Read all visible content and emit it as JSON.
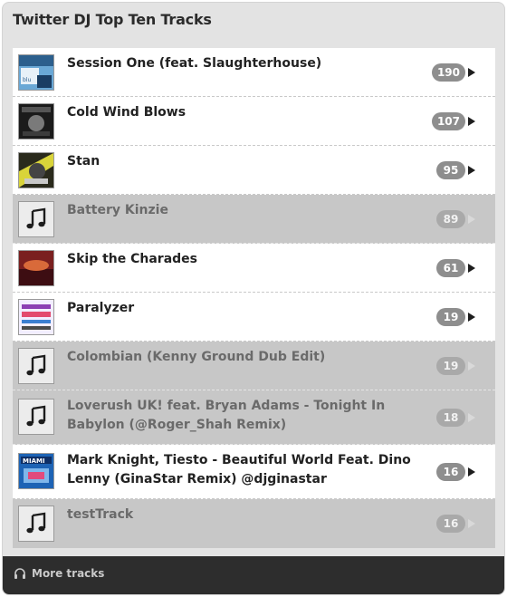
{
  "header": {
    "title": "Twitter DJ Top Ten Tracks"
  },
  "tracks": [
    {
      "title": "Session One (feat. Slaughterhouse)",
      "count": "190",
      "playable": true,
      "art": "art-session"
    },
    {
      "title": "Cold Wind Blows",
      "count": "107",
      "playable": true,
      "art": "art-cold"
    },
    {
      "title": "Stan",
      "count": "95",
      "playable": true,
      "art": "art-stan"
    },
    {
      "title": "Battery Kinzie",
      "count": "89",
      "playable": false,
      "art": "music-note-icon"
    },
    {
      "title": "Skip the Charades",
      "count": "61",
      "playable": true,
      "art": "art-skip"
    },
    {
      "title": "Paralyzer",
      "count": "19",
      "playable": true,
      "art": "art-paralyzer"
    },
    {
      "title": "Colombian (Kenny Ground Dub Edit)",
      "count": "19",
      "playable": false,
      "art": "music-note-icon"
    },
    {
      "title": "Loverush UK! feat. Bryan Adams - Tonight In Babylon (@Roger_Shah Remix)",
      "count": "18",
      "playable": false,
      "art": "music-note-icon"
    },
    {
      "title": "Mark Knight, Tiesto - Beautiful World Feat. Dino Lenny (GinaStar Remix) @djginastar",
      "count": "16",
      "playable": true,
      "art": "art-miami"
    },
    {
      "title": "testTrack",
      "count": "16",
      "playable": false,
      "art": "music-note-icon"
    }
  ],
  "footer": {
    "label": "More tracks",
    "icon": "headphones-icon"
  },
  "colors": {
    "panel_bg": "#e3e3e3",
    "disabled_row_bg": "#c7c7c7",
    "badge_bg": "#8e8e8e",
    "footer_bg": "#2d2d2d"
  }
}
